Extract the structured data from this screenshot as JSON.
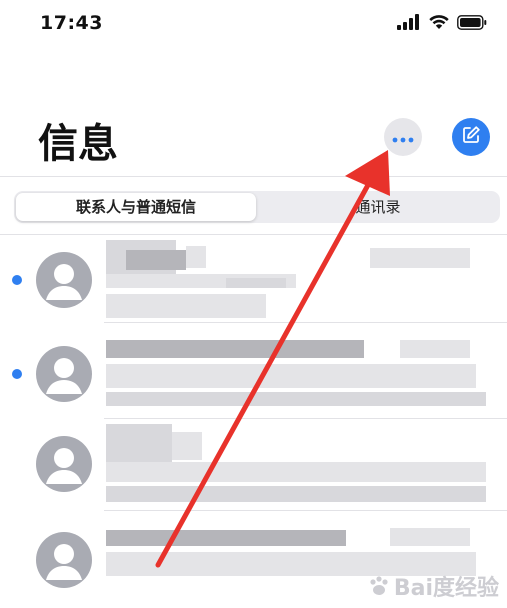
{
  "status_bar": {
    "time": "17:43",
    "icons": [
      "signal-icon",
      "wifi-icon",
      "battery-icon"
    ]
  },
  "header": {
    "title": "信息",
    "more_icon": "more-dots-icon",
    "compose_icon": "compose-icon"
  },
  "segmented_control": {
    "tabs": [
      {
        "label": "联系人与普通短信",
        "selected": true
      },
      {
        "label": "通讯录",
        "selected": false
      }
    ]
  },
  "colors": {
    "accent": "#2f7ff0",
    "annotation_arrow": "#e8322b",
    "avatar_gray": "#a9abb3"
  },
  "messages": [
    {
      "unread": true
    },
    {
      "unread": true
    },
    {
      "unread": false
    },
    {
      "unread": false
    }
  ],
  "watermark": {
    "text": "Bai度经验"
  }
}
